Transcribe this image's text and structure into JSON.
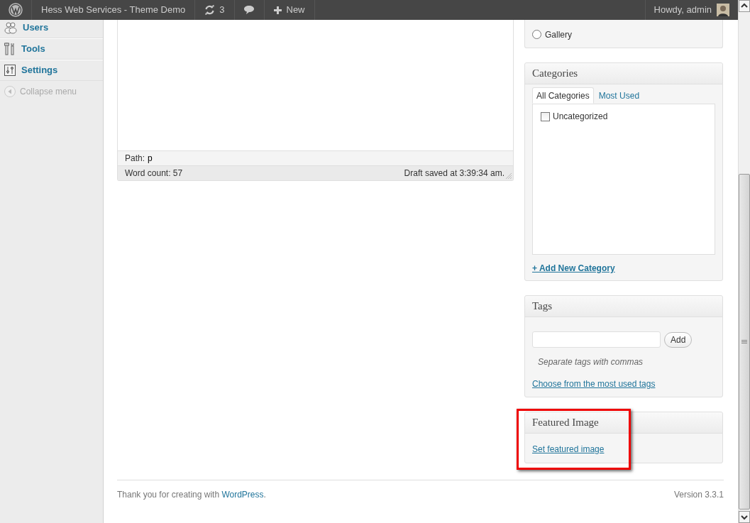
{
  "admin_bar": {
    "site_title": "Hess Web Services - Theme Demo",
    "updates_count": "3",
    "new_label": "New",
    "greeting": "Howdy, admin"
  },
  "sidebar": {
    "items": [
      {
        "label": "Users",
        "kind": "users"
      },
      {
        "label": "Tools",
        "kind": "tools"
      },
      {
        "label": "Settings",
        "kind": "settings"
      }
    ],
    "collapse_label": "Collapse menu"
  },
  "editor": {
    "path_label": "Path:",
    "path_value": "p",
    "word_count": "Word count: 57",
    "draft_status": "Draft saved at 3:39:34 am."
  },
  "format_box": {
    "options": [
      {
        "label": "Gallery",
        "selected": false
      }
    ]
  },
  "categories_box": {
    "title": "Categories",
    "tabs": [
      {
        "label": "All Categories",
        "selected": true
      },
      {
        "label": "Most Used",
        "selected": false
      }
    ],
    "items": [
      {
        "label": "Uncategorized",
        "checked": false
      }
    ],
    "add_link": "+ Add New Category"
  },
  "tags_box": {
    "title": "Tags",
    "add_button": "Add",
    "hint": "Separate tags with commas",
    "choose_link": "Choose from the most used tags"
  },
  "featured_image_box": {
    "title": "Featured Image",
    "link": "Set featured image",
    "highlighted": true
  },
  "footer": {
    "thanks_prefix": "Thank you for creating with ",
    "thanks_link": "WordPress",
    "thanks_suffix": ".",
    "version": "Version 3.3.1"
  }
}
